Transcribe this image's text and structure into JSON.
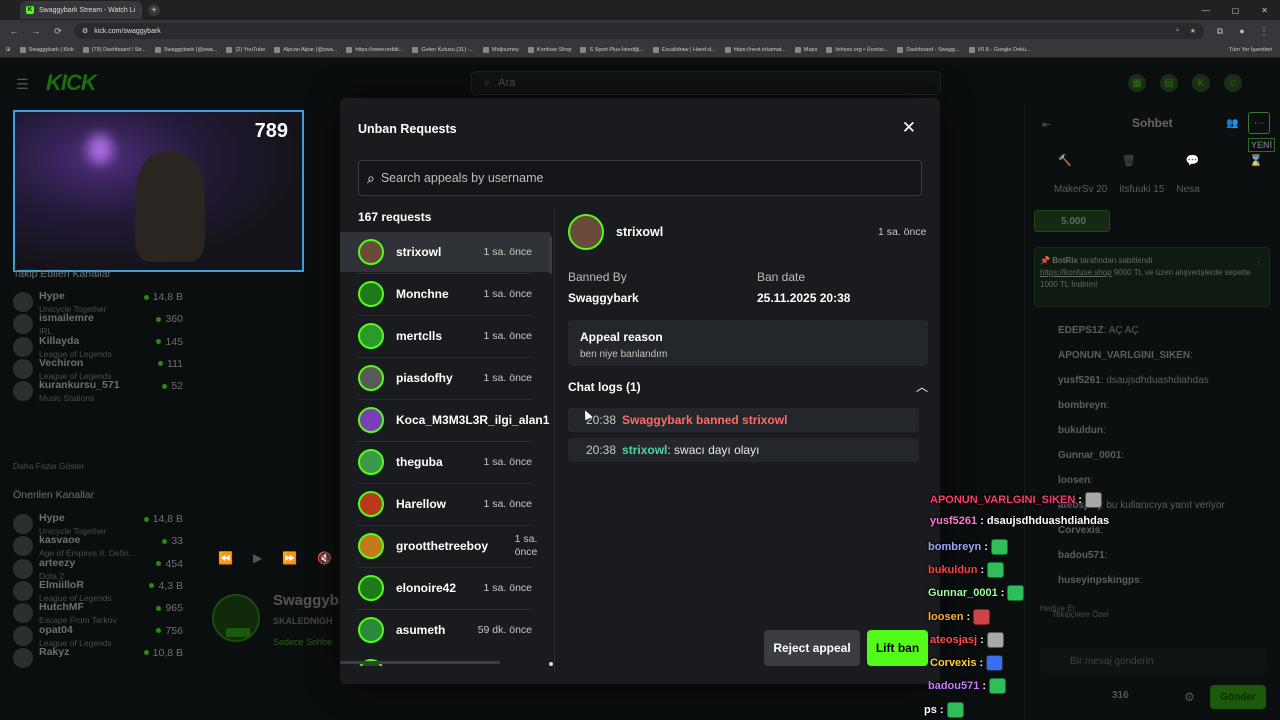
{
  "browser": {
    "tab_title": "Swaggybark Stream - Watch Li",
    "url": "kick.com/swaggybark",
    "bookmarks": [
      "Swaggybark | Kick",
      "(79) Dashboard / Str...",
      "Swaggybark (@swa...",
      "(2) YouTube",
      "Alpcan Alpar (@swa...",
      "https://www.reddit...",
      "Gelen Kutusu (31) -...",
      "Midjourney",
      "Konfuse Shop",
      "S Sport Plus-İstediği...",
      "Excalidraw | Hand-d...",
      "https://next.inkamat...",
      "Maps",
      "lichess.org • Ücretsi...",
      "Dashboard - Swagg...",
      "V0.8 - Google Dokü..."
    ],
    "bookmarks_right": "Tüm Yer İşaretleri"
  },
  "kick": {
    "logo": "KICK",
    "search_placeholder": "Ara"
  },
  "stream_preview": {
    "viewer_number": "789"
  },
  "sidebar": {
    "followed_header": "Takip Edilen Kanallar",
    "followed": [
      {
        "name": "Hype",
        "sub": "Unicycle Together",
        "count": "14,8 B"
      },
      {
        "name": "ismailemre",
        "sub": "IRL",
        "count": "360"
      },
      {
        "name": "Killayda",
        "sub": "League of Legends",
        "count": "145"
      },
      {
        "name": "Vechiron",
        "sub": "League of Legends",
        "count": "111"
      },
      {
        "name": "kurankursu_571",
        "sub": "Music Stations",
        "count": "52"
      }
    ],
    "show_more": "Daha Fazla Göster",
    "recommended_header": "Önerilen Kanallar",
    "recommended": [
      {
        "name": "Hype",
        "sub": "Unicycle Together",
        "count": "14,8 B"
      },
      {
        "name": "kasvaoe",
        "sub": "Age of Empires II: Defin...",
        "count": "33"
      },
      {
        "name": "arteezy",
        "sub": "Dota 2",
        "count": "454"
      },
      {
        "name": "ElmiilloR",
        "sub": "League of Legends",
        "count": "4,3 B"
      },
      {
        "name": "HutchMF",
        "sub": "Escape From Tarkov",
        "count": "965"
      },
      {
        "name": "opat04",
        "sub": "League of Legends",
        "count": "756"
      },
      {
        "name": "Rakyz",
        "sub": "",
        "count": "10,8 B"
      }
    ]
  },
  "channel": {
    "name": "Swaggybark",
    "subtitle": "SKALEDNIGH",
    "note": "Sadece Sohbe",
    "live": "LIVE"
  },
  "chat": {
    "title": "Sohbet",
    "new_badge": "YENİ",
    "top_users": [
      {
        "name": "MakerSv",
        "score": "20"
      },
      {
        "name": "itsfuuki",
        "score": "15"
      },
      {
        "name": "Nesa",
        "score": ""
      }
    ],
    "goal": "5.000",
    "pinned_by": "BotRix",
    "pinned_label": "tarafından sabitlendi",
    "pinned_link": "https://konfuse.shop",
    "pinned_text": " 9000 TL ve üzeri alışverişlerde sepette 1000 TL İndirim!",
    "lines": [
      {
        "user": "EDEPS1Z",
        "msg": ": AÇ AÇ"
      },
      {
        "user": "APONUN_VARLGINI_SIKEN",
        "msg": ":"
      },
      {
        "user": "yusf5261",
        "msg": ": dsaujsdhduashdiahdas"
      },
      {
        "user": "bombreyn",
        "msg": ":"
      },
      {
        "user": "bukuldun",
        "msg": ":"
      },
      {
        "user": "Gunnar_0001",
        "msg": ":"
      },
      {
        "user": "loosen",
        "msg": ":"
      },
      {
        "user": "ateosjasj",
        "msg": ": bu kullanıcıya yanıt veriyor"
      },
      {
        "user": "Corvexis",
        "msg": ":"
      },
      {
        "user": "badou571",
        "msg": ":"
      },
      {
        "user": "huseyinpskingps",
        "msg": ":"
      }
    ],
    "gift_label": "Hediye Et",
    "followers_label": "Takipçilere Özel",
    "input_placeholder": "Bir mesaj gönderin",
    "count": "316",
    "send": "Gönder"
  },
  "overlay_chat": [
    {
      "user": "APONUN_VARLGINI_SIKEN",
      "color": "#ff3b6b",
      "msg": ":",
      "emote": "gray"
    },
    {
      "user": "yusf5261",
      "color": "#ff7ad9",
      "msg": ": dsaujsdhduashdiahdas",
      "emote": ""
    },
    {
      "user": "bombreyn",
      "color": "#9aa8ff",
      "msg": ":",
      "emote": "green"
    },
    {
      "user": "bukuldun",
      "color": "#ff4040",
      "msg": ":",
      "emote": "green"
    },
    {
      "user": "Gunnar_0001",
      "color": "#9cff9c",
      "msg": ":",
      "emote": "green"
    },
    {
      "user": "loosen",
      "color": "#ffb03b",
      "msg": ":",
      "emote": "red"
    },
    {
      "user": "ateosjasj",
      "color": "#ff4d4d",
      "msg": ":",
      "emote": "gray"
    },
    {
      "user": "Corvexis",
      "color": "#ffd23b",
      "msg": ":",
      "emote": "blue"
    },
    {
      "user": "badou571",
      "color": "#c77dff",
      "msg": ":",
      "emote": "green"
    },
    {
      "user": "ps",
      "color": "#ffffff",
      "msg": ":",
      "emote": "green"
    }
  ],
  "modal": {
    "title": "Unban Requests",
    "search_placeholder": "Search appeals by username",
    "request_count": "167 requests",
    "requests": [
      {
        "user": "strixowl",
        "time": "1 sa. önce",
        "color": "#6a4a3a"
      },
      {
        "user": "Monchne",
        "time": "1 sa. önce",
        "color": "#1f7a1a"
      },
      {
        "user": "mertclls",
        "time": "1 sa. önce",
        "color": "#2c9a2a"
      },
      {
        "user": "piasdofhy",
        "time": "1 sa. önce",
        "color": "#5a5a5a"
      },
      {
        "user": "Koca_M3M3L3R_ilgi_alan1",
        "time": "",
        "color": "#7a3fb8"
      },
      {
        "user": "theguba",
        "time": "1 sa. önce",
        "color": "#3a9a4a"
      },
      {
        "user": "Harellow",
        "time": "1 sa. önce",
        "color": "#b83a1a"
      },
      {
        "user": "grootthetreeboy",
        "time": "1 sa. önce",
        "color": "#c47a1a"
      },
      {
        "user": "elonoire42",
        "time": "1 sa. önce",
        "color": "#1f7a1a"
      },
      {
        "user": "asumeth",
        "time": "59 dk. önce",
        "color": "#2a8a3a"
      }
    ],
    "selected": {
      "user": "strixowl",
      "time": "1 sa. önce",
      "banned_by_label": "Banned By",
      "banned_by": "Swaggybark",
      "ban_date_label": "Ban date",
      "ban_date": "25.11.2025 20:38",
      "appeal_reason_label": "Appeal reason",
      "appeal_reason": "ben niye banlandım",
      "chat_logs_label": "Chat logs (1)",
      "logs": [
        {
          "time": "20:38",
          "type": "ban",
          "text": "Swaggybark banned strixowl"
        },
        {
          "time": "20:38",
          "type": "msg",
          "user": "strixowl",
          "text": ": swacı dayı olayı"
        }
      ]
    },
    "reject_label": "Reject appeal",
    "lift_label": "Lift ban"
  }
}
